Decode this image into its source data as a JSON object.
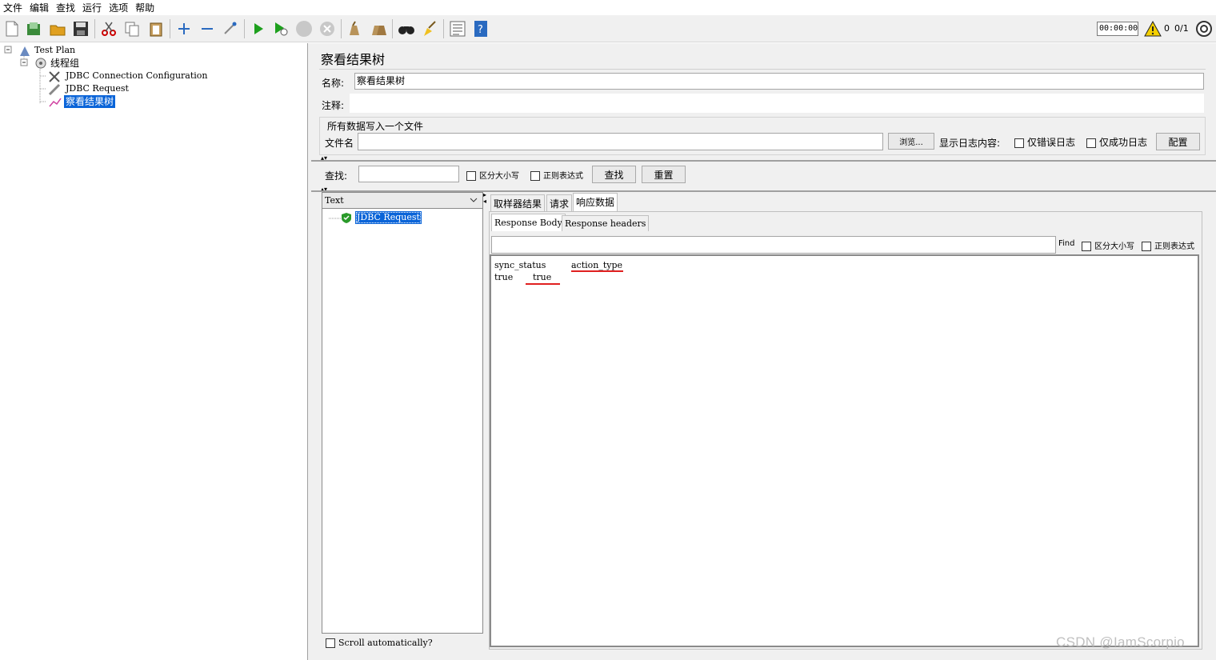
{
  "menu": [
    "文件",
    "编辑",
    "查找",
    "运行",
    "选项",
    "帮助"
  ],
  "toolbar": {
    "timer": "00:00:00",
    "warning_count": "0",
    "thread_count": "0/1"
  },
  "tree": {
    "plan": "Test Plan",
    "thread_group": "线程组",
    "jdbc_config": "JDBC Connection Configuration",
    "jdbc_request": "JDBC Request",
    "listener": "察看结果树"
  },
  "panel": {
    "title": "察看结果树",
    "name_label": "名称:",
    "name_value": "察看结果树",
    "comment_label": "注释:",
    "file_section": "所有数据写入一个文件",
    "filename_label": "文件名",
    "browse_button": "浏览...",
    "log_label": "显示日志内容:",
    "errors_only": "仅错误日志",
    "success_only": "仅成功日志",
    "configure_button": "配置"
  },
  "search": {
    "label": "查找:",
    "case_sensitive": "区分大小写",
    "regex": "正则表达式",
    "find_button": "查找",
    "reset_button": "重置"
  },
  "results": {
    "renderer": "Text",
    "sample": "JDBC Request",
    "scroll_auto": "Scroll automatically?",
    "tabs": [
      "取样器结果",
      "请求",
      "响应数据"
    ],
    "subtabs": [
      "Response Body",
      "Response headers"
    ],
    "find_label": "Find",
    "find_case": "区分大小写",
    "find_regex": "正则表达式",
    "body_headers": [
      "sync_status",
      "action_type"
    ],
    "body_values": [
      "true",
      "true"
    ]
  },
  "watermark": "CSDN @IamScorpio",
  "colors": {
    "selection": "#0a64d8",
    "underline": "#e02020",
    "play": "#1ea01e"
  }
}
